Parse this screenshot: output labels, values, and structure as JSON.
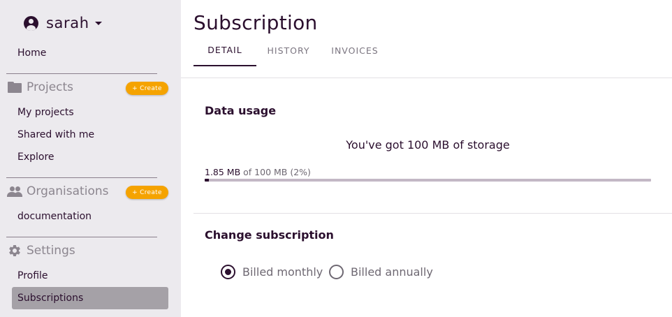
{
  "user": {
    "name": "sarah"
  },
  "sidebar": {
    "home": "Home",
    "projects": {
      "title": "Projects",
      "create": "+ Create",
      "items": [
        "My projects",
        "Shared with me",
        "Explore"
      ]
    },
    "organisations": {
      "title": "Organisations",
      "create": "+ Create",
      "items": [
        "documentation"
      ]
    },
    "settings": {
      "title": "Settings",
      "items": [
        "Profile",
        "Subscriptions"
      ],
      "active": "Subscriptions"
    }
  },
  "page": {
    "title": "Subscription",
    "tabs": [
      "DETAIL",
      "HISTORY",
      "INVOICES"
    ],
    "active_tab": "DETAIL"
  },
  "data_usage": {
    "title": "Data usage",
    "storage_message": "You've got 100 MB of storage",
    "used": "1.85 MB",
    "of_total": "of 100 MB (2%)",
    "percent": 2
  },
  "change_subscription": {
    "title": "Change subscription",
    "options": [
      "Billed monthly",
      "Billed annually"
    ],
    "selected": "Billed monthly"
  },
  "colors": {
    "primary": "#2b0f2e",
    "accent": "#f5a300",
    "sidebar_bg": "#eceaee"
  }
}
